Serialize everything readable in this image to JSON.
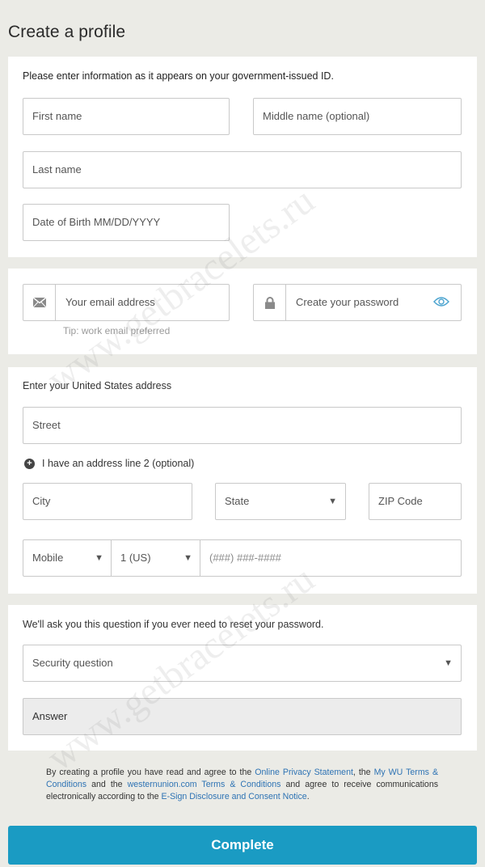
{
  "page": {
    "title": "Create a profile"
  },
  "identity": {
    "instruction": "Please enter information as it appears on your government-issued ID.",
    "first_name": "First name",
    "middle_name": "Middle name (optional)",
    "last_name": "Last name",
    "dob": "Date of Birth MM/DD/YYYY"
  },
  "account": {
    "email_placeholder": "Your email address",
    "email_icon": "envelope-icon",
    "email_tip": "Tip: work email preferred",
    "password_placeholder": "Create your password",
    "password_icon": "lock-icon",
    "password_toggle_icon": "eye-icon"
  },
  "address": {
    "heading": "Enter your United States address",
    "street": "Street",
    "add_line2": "I have an address line 2 (optional)",
    "city": "City",
    "state": "State",
    "zip": "ZIP Code",
    "phone_type": "Mobile",
    "country_code": "1 (US)",
    "phone_placeholder": "(###) ###-####"
  },
  "security": {
    "intro": "We'll ask you this question if you ever need to reset your password.",
    "question_placeholder": "Security question",
    "answer_placeholder": "Answer"
  },
  "terms": {
    "p1": "By creating a profile you have read and agree to the ",
    "link1": "Online Privacy Statement",
    "p2": ", the ",
    "link2": "My WU Terms & Conditions",
    "p3": " and the ",
    "link3": "westernunion.com Terms & Conditions",
    "p4": " and agree to receive communications electronically according to the ",
    "link4": "E-Sign Disclosure and Consent Notice",
    "p5": "."
  },
  "actions": {
    "complete": "Complete"
  },
  "watermark": {
    "text": "www.getbracelets.ru"
  },
  "colors": {
    "accent": "#1a9bc3",
    "link": "#2e73b4",
    "eye": "#4aa3cf"
  }
}
